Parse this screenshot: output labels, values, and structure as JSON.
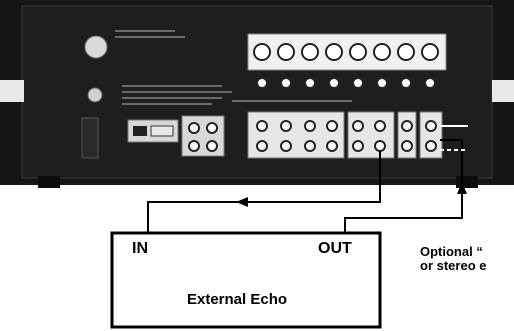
{
  "labels": {
    "in": "IN",
    "out": "OUT",
    "device": "External Echo",
    "optional_line1": "Optional “",
    "optional_line2": "or stereo e"
  },
  "panel": {
    "xlr_count": 8,
    "rca_rows": 2
  },
  "colors": {
    "panel": "#1a1a1a",
    "line": "#000000",
    "background": "#ffffff"
  }
}
